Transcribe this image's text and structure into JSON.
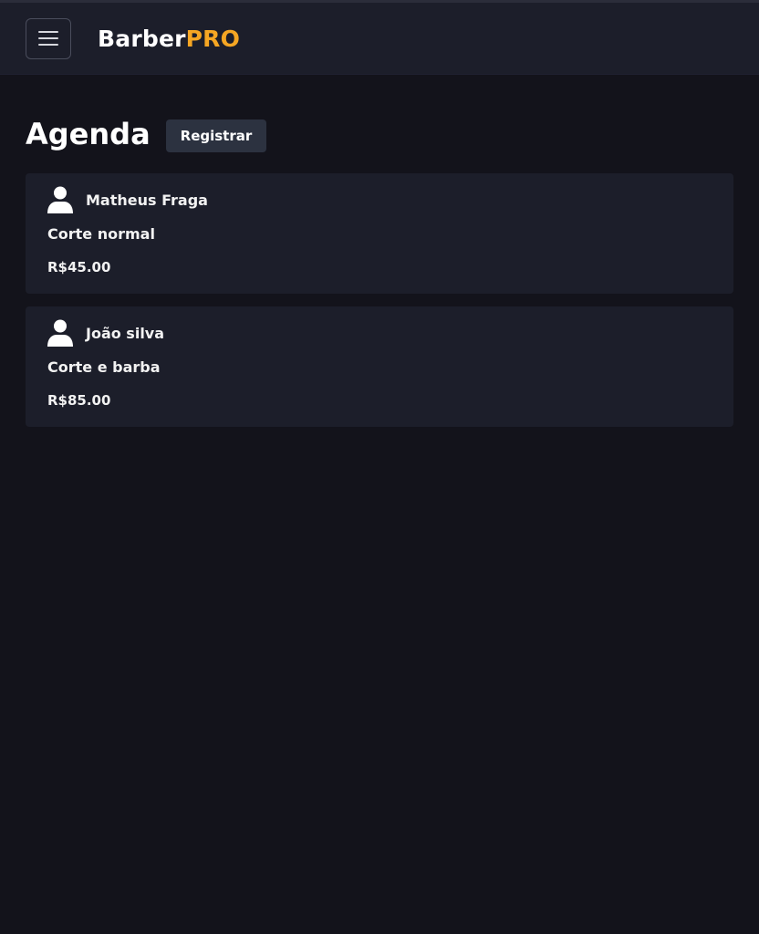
{
  "header": {
    "brand_part1": "Barber",
    "brand_part2": "PRO",
    "menu_icon": "hamburger-menu-icon"
  },
  "page": {
    "title": "Agenda",
    "register_label": "Registrar"
  },
  "appointments": [
    {
      "client": "Matheus Fraga",
      "service": "Corte normal",
      "price": "R$45.00",
      "icon": "user-icon"
    },
    {
      "client": "João silva",
      "service": "Corte e barba",
      "price": "R$85.00",
      "icon": "user-icon"
    }
  ],
  "colors": {
    "background": "#13131b",
    "surface": "#1c1e2a",
    "accent": "#f5a623",
    "button": "#2c3240"
  }
}
